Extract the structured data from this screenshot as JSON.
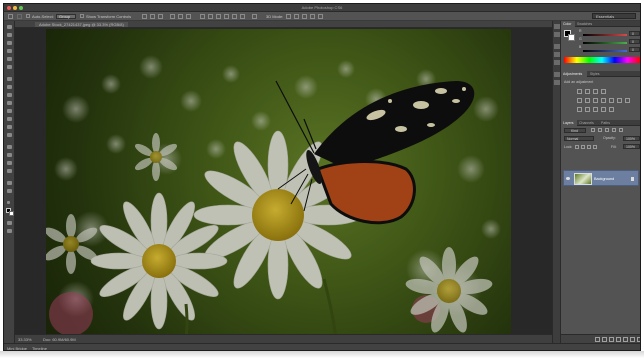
{
  "app": {
    "title": "Adobe Photoshop CS6"
  },
  "options_bar": {
    "auto_select_label": "Auto-Select:",
    "auto_select_value": "Group",
    "transform_controls_label": "Show Transform Controls",
    "mode_3d_label": "3D Mode:",
    "workspace": "Essentials"
  },
  "document": {
    "tab_title": "Adobe Stock_27421437.jpeg @ 33.3% (RGB/8)",
    "zoom": "33.33%",
    "doc_info": "Doc: 60.9M/60.9M"
  },
  "bottom_tabs": [
    "Mini Bridge",
    "Timeline"
  ],
  "panels": {
    "color_tabs": [
      "Color",
      "Swatches"
    ],
    "color_sliders": [
      {
        "channel": "R",
        "value": "0",
        "color": "#d94a4a"
      },
      {
        "channel": "G",
        "value": "0",
        "color": "#4ab04a"
      },
      {
        "channel": "B",
        "value": "0",
        "color": "#4a6ad9"
      }
    ],
    "adjustments_tabs": [
      "Adjustments",
      "Styles"
    ],
    "adjustments_hint": "Add an adjustment",
    "layers_tabs": [
      "Layers",
      "Channels",
      "Paths"
    ],
    "kind_label": "Kind",
    "blend_mode": "Normal",
    "opacity_label": "Opacity:",
    "opacity_value": "100%",
    "lock_label": "Lock:",
    "fill_label": "Fill:",
    "fill_value": "100%",
    "layer_name": "Background"
  },
  "colors": {
    "ui_bg": "#535353",
    "layer_selected": "#6c7fa1",
    "flower_petal": "#e9ecdd",
    "flower_center": "#d4b01e",
    "butterfly_orange": "#c4511a",
    "butterfly_black": "#111111"
  }
}
